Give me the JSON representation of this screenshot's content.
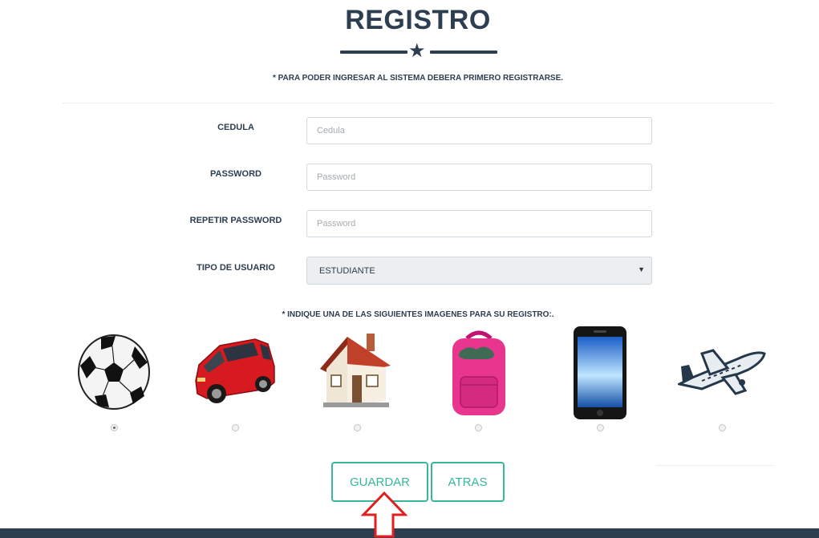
{
  "header": {
    "title": "REGISTRO",
    "notice": "* PARA PODER INGRESAR AL SISTEMA DEBERA PRIMERO REGISTRARSE."
  },
  "form": {
    "cedula": {
      "label": "CEDULA",
      "placeholder": "Cedula",
      "value": ""
    },
    "password": {
      "label": "PASSWORD",
      "placeholder": "Password",
      "value": ""
    },
    "repeat_password": {
      "label": "REPETIR PASSWORD",
      "placeholder": "Password",
      "value": ""
    },
    "user_type": {
      "label": "TIPO DE USUARIO",
      "selected": "ESTUDIANTE"
    }
  },
  "images": {
    "notice": "* INDIQUE UNA DE LAS SIGUIENTES IMAGENES PARA SU REGISTRO:.",
    "options": [
      {
        "icon": "soccer-ball",
        "selected": true
      },
      {
        "icon": "red-car",
        "selected": false
      },
      {
        "icon": "house",
        "selected": false
      },
      {
        "icon": "pink-backpack",
        "selected": false
      },
      {
        "icon": "smartphone",
        "selected": false
      },
      {
        "icon": "airplane",
        "selected": false
      }
    ]
  },
  "buttons": {
    "save_label": "GUARDAR",
    "back_label": "ATRAS"
  },
  "colors": {
    "primary": "#2c3e50",
    "accent": "#35b79a",
    "annotation_arrow": "#e02020"
  }
}
